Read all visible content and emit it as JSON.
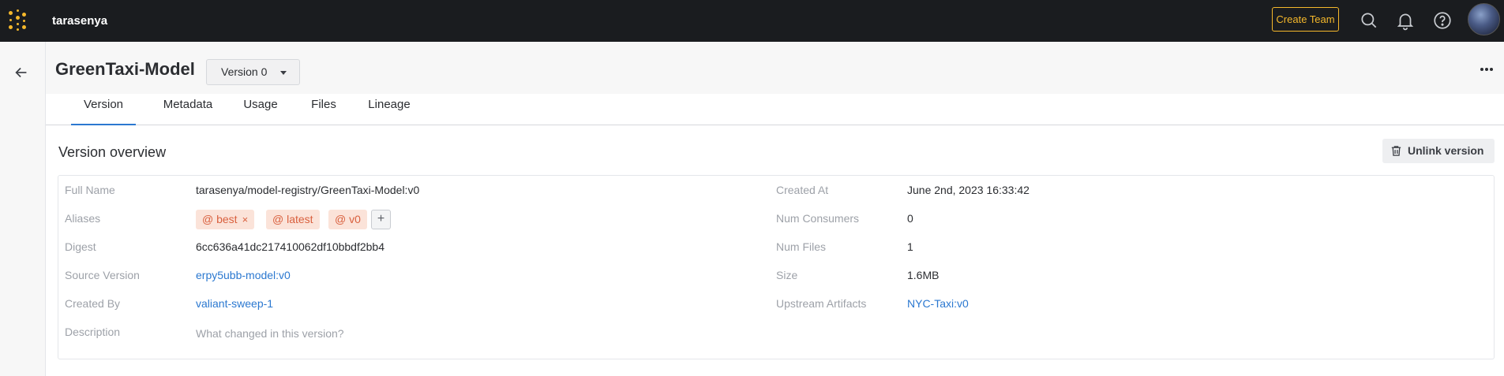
{
  "topbar": {
    "username": "tarasenya",
    "create_team_label": "Create Team",
    "icons": [
      "grid-logo-icon",
      "search-icon",
      "bell-icon",
      "help-icon",
      "avatar"
    ]
  },
  "header": {
    "title": "GreenTaxi-Model",
    "version_select": "Version 0"
  },
  "tabs": [
    {
      "label": "Version",
      "active": true
    },
    {
      "label": "Metadata",
      "active": false
    },
    {
      "label": "Usage",
      "active": false
    },
    {
      "label": "Files",
      "active": false
    },
    {
      "label": "Lineage",
      "active": false
    }
  ],
  "overview": {
    "title": "Version overview",
    "unlink_label": "Unlink version",
    "left": {
      "full_name": {
        "label": "Full Name",
        "value": "tarasenya/model-registry/GreenTaxi-Model:v0"
      },
      "aliases": {
        "label": "Aliases",
        "items": [
          "@ best",
          "@ latest",
          "@ v0"
        ],
        "add": "+",
        "remove_glyph": "×"
      },
      "digest": {
        "label": "Digest",
        "value": "6cc636a41dc217410062df10bbdf2bb4"
      },
      "source_version": {
        "label": "Source Version",
        "value": "erpy5ubb-model:v0"
      },
      "created_by": {
        "label": "Created By",
        "value": "valiant-sweep-1"
      },
      "description": {
        "label": "Description",
        "placeholder": "What changed in this version?"
      }
    },
    "right": {
      "created_at": {
        "label": "Created At",
        "value": "June 2nd, 2023 16:33:42"
      },
      "num_consumers": {
        "label": "Num Consumers",
        "value": "0"
      },
      "num_files": {
        "label": "Num Files",
        "value": "1"
      },
      "size": {
        "label": "Size",
        "value": "1.6MB"
      },
      "upstream_artifacts": {
        "label": "Upstream Artifacts",
        "value": "NYC-Taxi:v0"
      }
    }
  },
  "colors": {
    "topbar_bg": "#1a1c1f",
    "accent_yellow": "#f5b82b",
    "link_blue": "#2b78d0",
    "alias_bg": "#fbe3d9",
    "alias_text": "#d9603e"
  }
}
